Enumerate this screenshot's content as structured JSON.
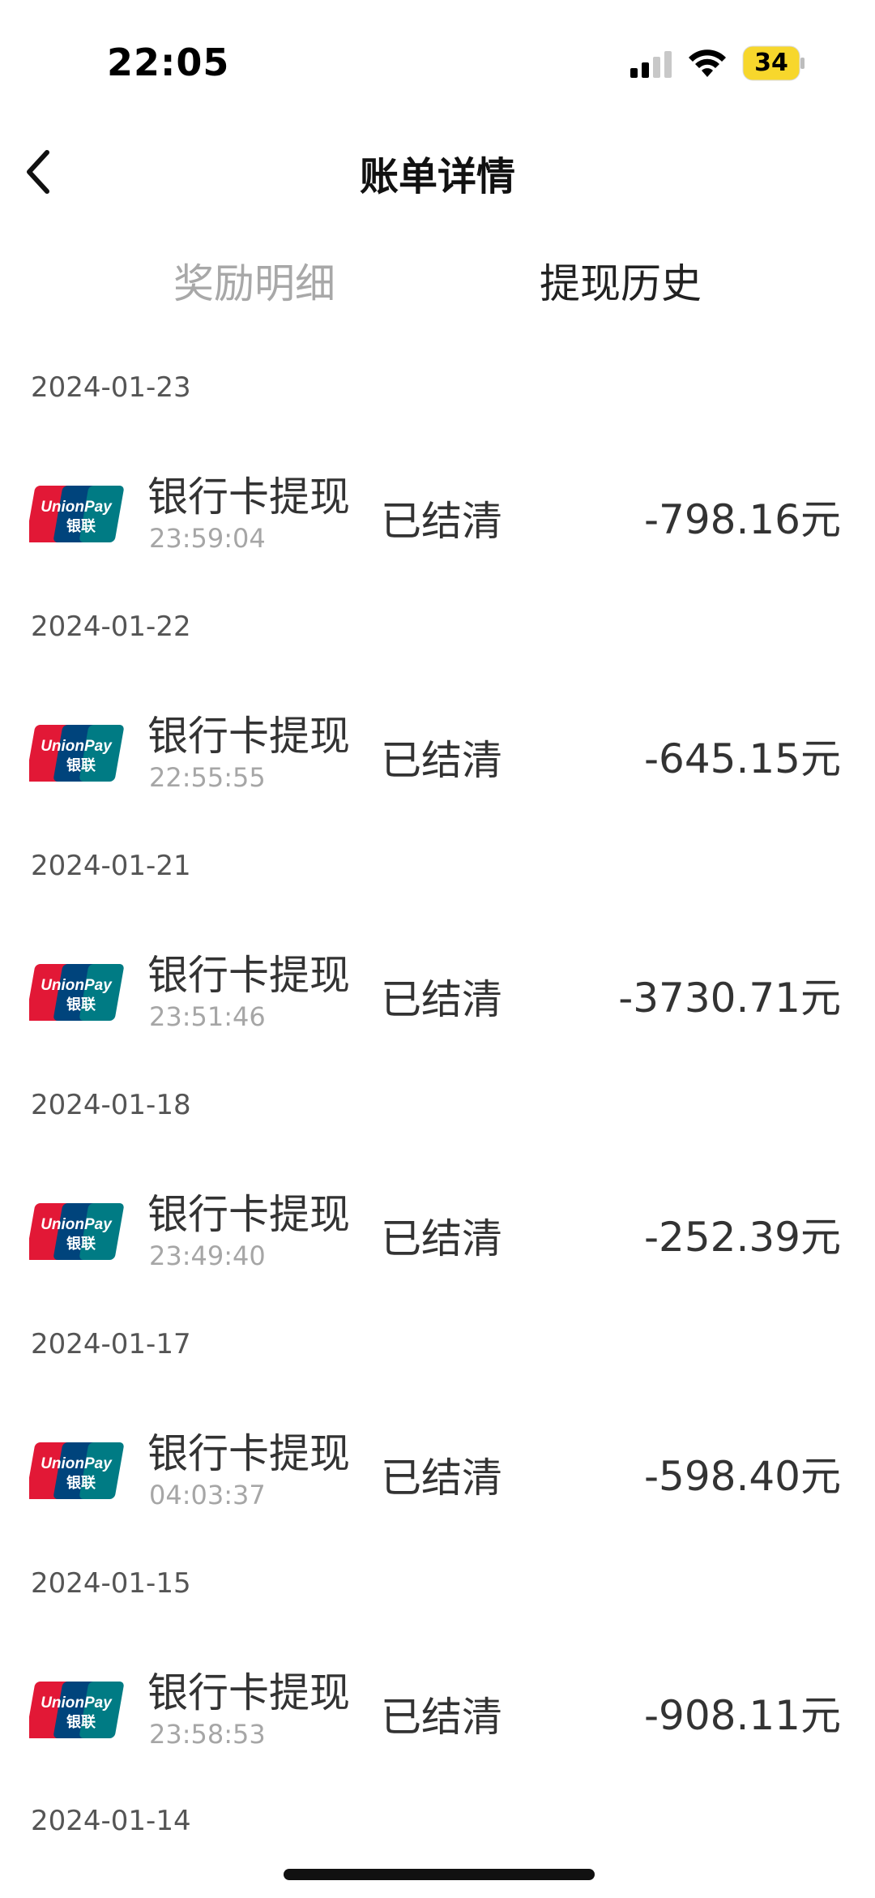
{
  "status_bar": {
    "time": "22:05",
    "battery": "34",
    "battery_color": "#f7d72c"
  },
  "nav": {
    "title": "账单详情"
  },
  "tabs": [
    {
      "label": "奖励明细",
      "active": false
    },
    {
      "label": "提现历史",
      "active": true
    }
  ],
  "records": [
    {
      "date": "2024-01-23",
      "title": "银行卡提现",
      "time": "23:59:04",
      "status": "已结清",
      "amount": "-798.16元"
    },
    {
      "date": "2024-01-22",
      "title": "银行卡提现",
      "time": "22:55:55",
      "status": "已结清",
      "amount": "-645.15元"
    },
    {
      "date": "2024-01-21",
      "title": "银行卡提现",
      "time": "23:51:46",
      "status": "已结清",
      "amount": "-3730.71元"
    },
    {
      "date": "2024-01-18",
      "title": "银行卡提现",
      "time": "23:49:40",
      "status": "已结清",
      "amount": "-252.39元"
    },
    {
      "date": "2024-01-17",
      "title": "银行卡提现",
      "time": "04:03:37",
      "status": "已结清",
      "amount": "-598.40元"
    },
    {
      "date": "2024-01-15",
      "title": "银行卡提现",
      "time": "23:58:53",
      "status": "已结清",
      "amount": "-908.11元"
    }
  ],
  "trailing_date": "2024-01-14",
  "card_logo": {
    "icon": "unionpay-icon",
    "text_top": "UnionPay",
    "text_bottom": "银联",
    "colors": [
      "#e21836",
      "#00447c",
      "#007b84"
    ]
  }
}
